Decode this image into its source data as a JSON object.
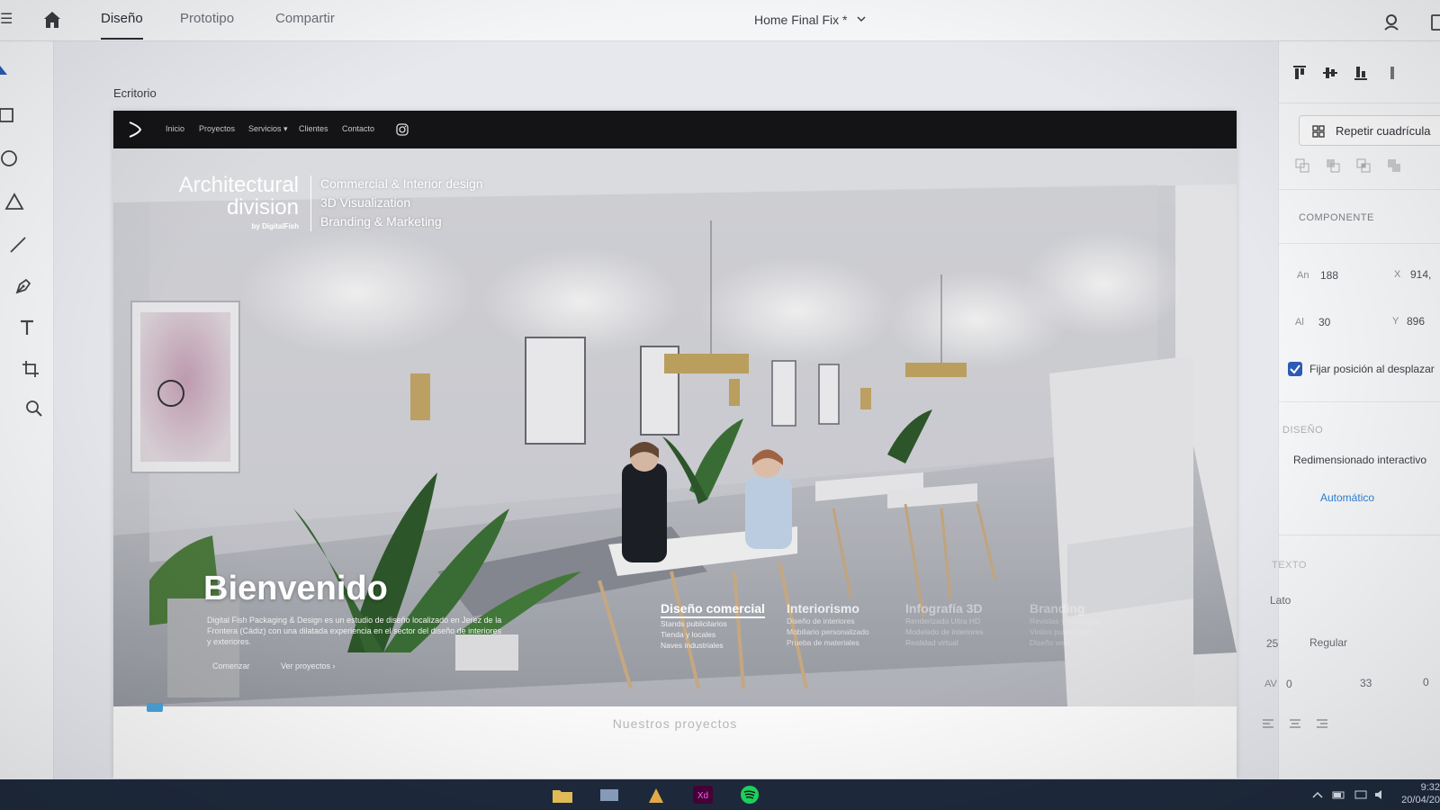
{
  "app": {
    "tabs": [
      {
        "label": "Diseño",
        "active": true
      },
      {
        "label": "Prototipo",
        "active": false
      },
      {
        "label": "Compartir",
        "active": false
      }
    ],
    "document_title": "Home Final Fix *"
  },
  "tools": [
    "select-tool",
    "rectangle-tool",
    "ellipse-tool",
    "triangle-tool",
    "line-tool",
    "pen-tool",
    "text-tool",
    "artboard-tool",
    "zoom-tool"
  ],
  "canvas": {
    "artboard_label": "Ecritorio"
  },
  "website": {
    "nav": [
      "Inicio",
      "Proyectos",
      "Servicios ▾",
      "Clientes",
      "Contacto"
    ],
    "brand": {
      "line1": "Architectural",
      "line2": "division",
      "by": "by DigitalFish"
    },
    "services": [
      "Commercial & Interior design",
      "3D Visualization",
      "Branding & Marketing"
    ],
    "welcome_title": "Bienvenido",
    "welcome_text": "Digital Fish Packaging & Design es un estudio de diseño localizado en Jerez de la Frontera (Cádiz) con una dilatada experiencia en el sector del diseño de interiores y exteriores.",
    "cta_contact": "Comenzar",
    "cta_projects": "Ver proyectos ›",
    "categories": [
      {
        "title": "Diseño comercial",
        "items": [
          "Stands publicitarios",
          "Tienda y locales",
          "Naves industriales"
        ]
      },
      {
        "title": "Interiorismo",
        "items": [
          "Diseño de interiores",
          "Mobiliario personalizado",
          "Prueba de materiales"
        ]
      },
      {
        "title": "Infografía 3D",
        "items": [
          "Renderizado Ultra HD",
          "Modelado de interiores",
          "Realidad virtual"
        ]
      },
      {
        "title": "Branding",
        "items": [
          "Revistas y catálogos",
          "Vinilos publicitarios",
          "Diseño web"
        ]
      }
    ],
    "projects_title": "Nuestros proyectos"
  },
  "panel": {
    "repeat_grid": "Repetir cuadrícula",
    "component_title": "COMPONENTE",
    "width_label": "An",
    "width_value": "188",
    "x_label": "X",
    "x_value": "914,",
    "height_label": "Al",
    "height_value": "30",
    "y_label": "Y",
    "y_value": "896",
    "fix_position": "Fijar posición al desplazar",
    "design_title": "DISEÑO",
    "resize_label": "Redimensionado interactivo",
    "resize_mode": "Automático",
    "text_title": "TEXTO",
    "font_family": "Lato",
    "font_size": "25",
    "font_weight": "Regular",
    "char_spacing_label": "AV",
    "char_spacing": "0",
    "line_spacing": "33",
    "paragraph_spacing": "0"
  },
  "taskbar": {
    "time": "9:32",
    "date": "20/04/20"
  },
  "colors": {
    "accent": "#2d5ab5",
    "link": "#2f7fd0",
    "site_nav": "#141416"
  }
}
